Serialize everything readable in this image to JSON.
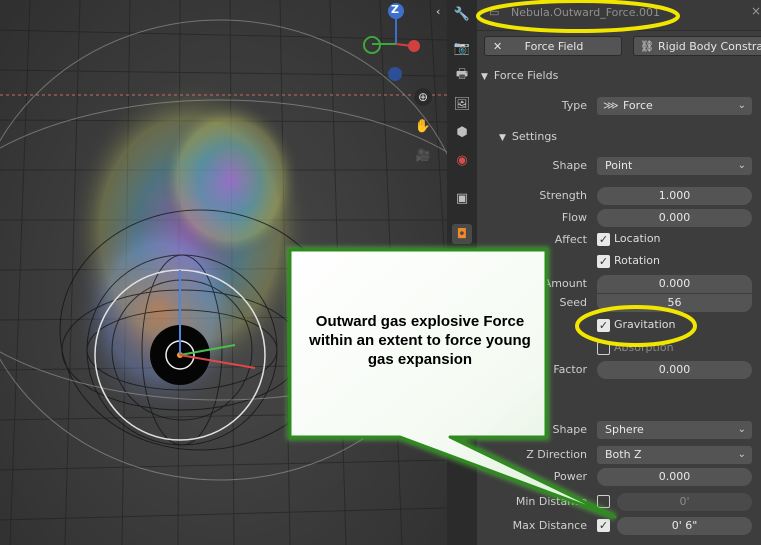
{
  "header": {
    "object_name": "Nebula.Outward_Force.001",
    "close_glyph": "×"
  },
  "tabs": {
    "force_field": "Force Field",
    "rigid_body": "Rigid Body Constraint"
  },
  "force_fields": {
    "section_label": "Force Fields",
    "type_label": "Type",
    "type_value": "Force"
  },
  "settings": {
    "section_label": "Settings",
    "shape_label": "Shape",
    "shape_value": "Point",
    "strength_label": "Strength",
    "strength_value": "1.000",
    "flow_label": "Flow",
    "flow_value": "0.000",
    "affect_label": "Affect",
    "location_label": "Location",
    "location_checked": true,
    "rotation_label": "Rotation",
    "rotation_checked": true,
    "amount_label": "Amount",
    "amount_value": "0.000",
    "seed_label": "Seed",
    "seed_value": "56",
    "gravitation_label": "Gravitation",
    "gravitation_checked": true,
    "absorption_label": "Absorption",
    "absorption_checked": false,
    "factor_label": "Factor",
    "factor_value": "0.000"
  },
  "falloff": {
    "shape_label": "Shape",
    "shape_value": "Sphere",
    "zdir_label": "Z Direction",
    "zdir_value": "Both Z",
    "power_label": "Power",
    "power_value": "0.000",
    "min_label": "Min Distance",
    "min_value": "0'",
    "min_checked": false,
    "max_label": "Max Distance",
    "max_value": "0' 6\"",
    "max_checked": true
  },
  "gizmo": {
    "z_label": "Z"
  },
  "callout": {
    "line1": "Outward gas explosive Force",
    "line2": "within an extent to force young",
    "line3": "gas expansion"
  },
  "colors": {
    "highlight": "#f2e600",
    "callout_border": "#2e8b1e",
    "accent_blue": "#4772b3"
  }
}
